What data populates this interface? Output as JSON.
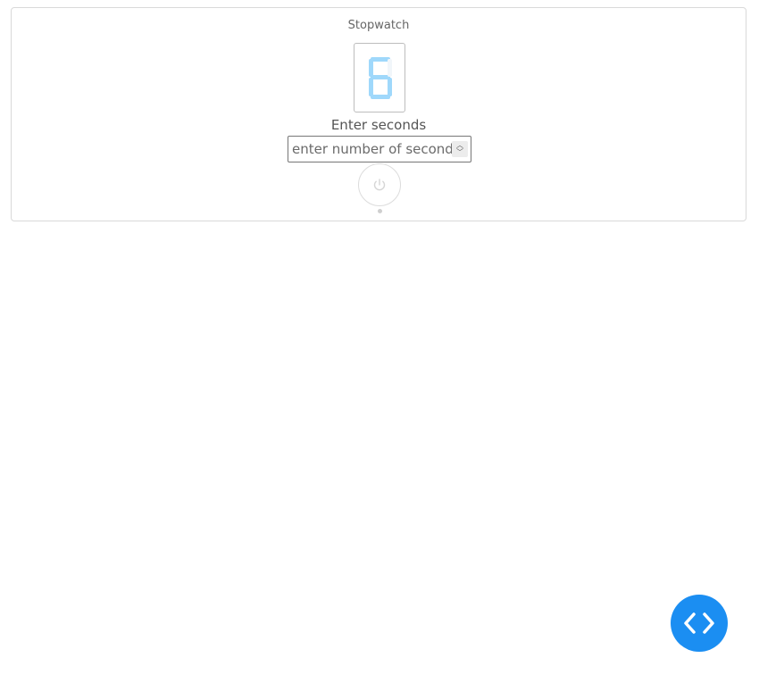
{
  "widget": {
    "title": "Stopwatch",
    "display_digit": "6",
    "input_label": "Enter seconds",
    "input_placeholder": "enter number of seconds",
    "input_value": ""
  },
  "colors": {
    "digit_color": "#9fd8fb",
    "fab_color": "#1b8ef2",
    "card_border": "#d9d9d9"
  },
  "icons": {
    "power": "power-icon",
    "code": "code-icon",
    "spinner": "spinner-arrows-icon"
  }
}
